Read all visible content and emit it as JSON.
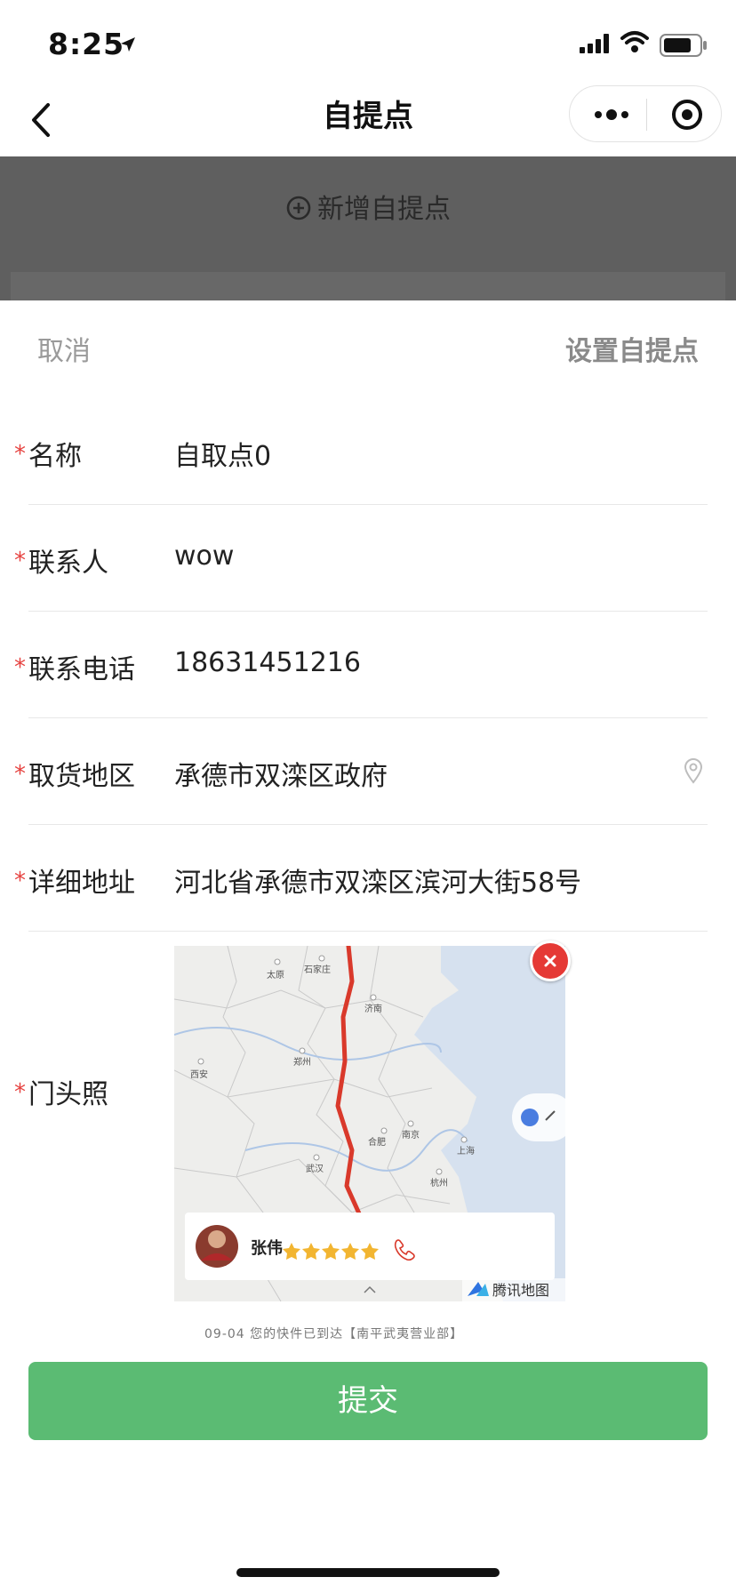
{
  "status_bar": {
    "time": "8:25"
  },
  "nav": {
    "title": "自提点"
  },
  "background_page": {
    "add_pickup_label": "新增自提点"
  },
  "sheet": {
    "cancel_label": "取消",
    "title": "设置自提点",
    "required_mark": "*",
    "fields": [
      {
        "label": "名称",
        "value": "自取点0"
      },
      {
        "label": "联系人",
        "value": "wow"
      },
      {
        "label": "联系电话",
        "value": "18631451216"
      },
      {
        "label": "取货地区",
        "value": "承德市双滦区政府",
        "trailing_icon": "location-pin-icon"
      },
      {
        "label": "详细地址",
        "value": "河北省承德市双滦区滨河大街58号"
      }
    ],
    "photo_field": {
      "label": "门头照",
      "courier_name": "张伟",
      "rating_stars": 5,
      "map_brand": "腾讯地图",
      "caption": "09-04 您的快件已到达【南平武夷营业部】",
      "map_labels": [
        "太原",
        "石家庄",
        "济南",
        "西安",
        "郑州",
        "合肥",
        "南京",
        "上海",
        "武汉",
        "杭州"
      ]
    },
    "submit_label": "提交"
  },
  "colors": {
    "accent_green": "#5bbb73",
    "required_red": "#e64340",
    "route_red": "#d9392b",
    "overlay": "#5f5f5f"
  }
}
